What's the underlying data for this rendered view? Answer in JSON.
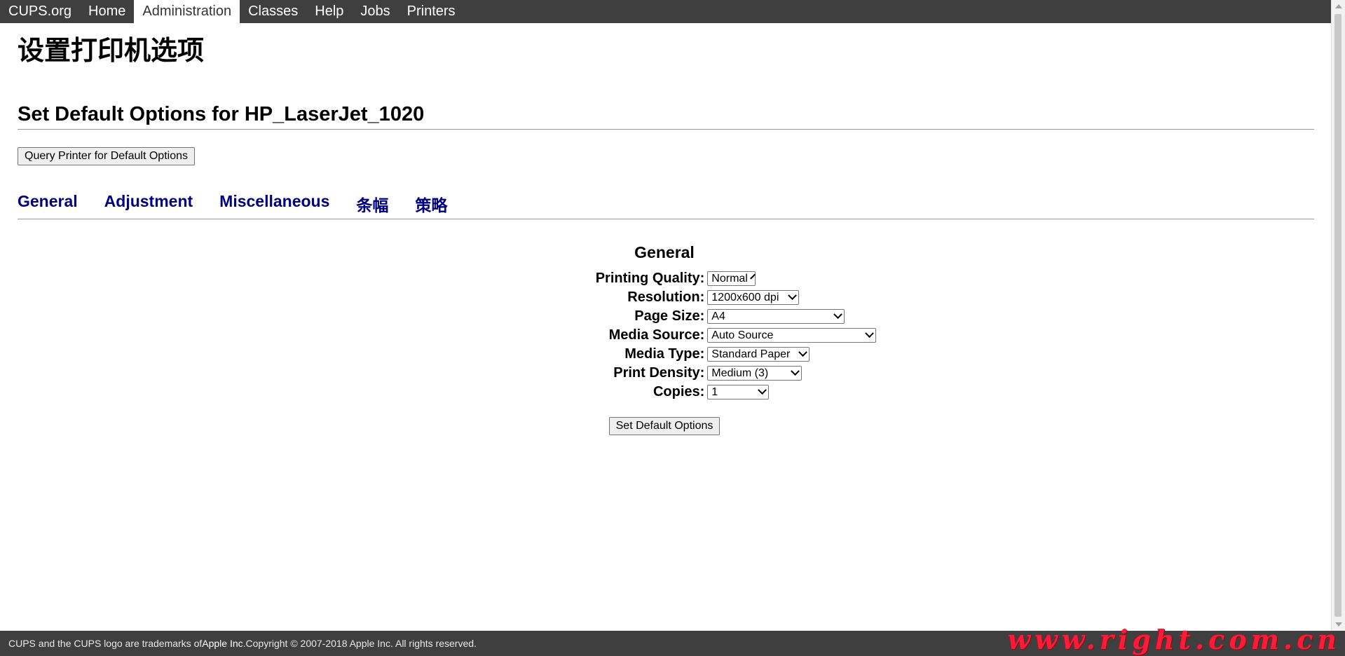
{
  "nav": {
    "items": [
      {
        "label": "CUPS.org",
        "active": false
      },
      {
        "label": "Home",
        "active": false
      },
      {
        "label": "Administration",
        "active": true
      },
      {
        "label": "Classes",
        "active": false
      },
      {
        "label": "Help",
        "active": false
      },
      {
        "label": "Jobs",
        "active": false
      },
      {
        "label": "Printers",
        "active": false
      }
    ]
  },
  "page": {
    "title": "设置打印机选项",
    "section_title": "Set Default Options for HP_LaserJet_1020",
    "query_button": "Query Printer for Default Options"
  },
  "tabs": [
    "General",
    "Adjustment",
    "Miscellaneous",
    "条幅",
    "策略"
  ],
  "form": {
    "heading": "General",
    "fields": [
      {
        "label": "Printing Quality:",
        "value": "Normal"
      },
      {
        "label": "Resolution:",
        "value": "1200x600 dpi"
      },
      {
        "label": "Page Size:",
        "value": "A4"
      },
      {
        "label": "Media Source:",
        "value": "Auto Source"
      },
      {
        "label": "Media Type:",
        "value": "Standard Paper"
      },
      {
        "label": "Print Density:",
        "value": "Medium (3)"
      },
      {
        "label": "Copies:",
        "value": "1"
      }
    ],
    "submit_button": "Set Default Options"
  },
  "footer": {
    "text_before": "CUPS and the CUPS logo are trademarks of ",
    "brand": "Apple Inc.",
    "text_after": " Copyright © 2007-2018 Apple Inc. All rights reserved."
  },
  "watermark": "www.right.com.cn",
  "colors": {
    "nav_bg": "#3f3f3f",
    "tab_link": "#000080",
    "watermark": "#ff1a3a"
  }
}
